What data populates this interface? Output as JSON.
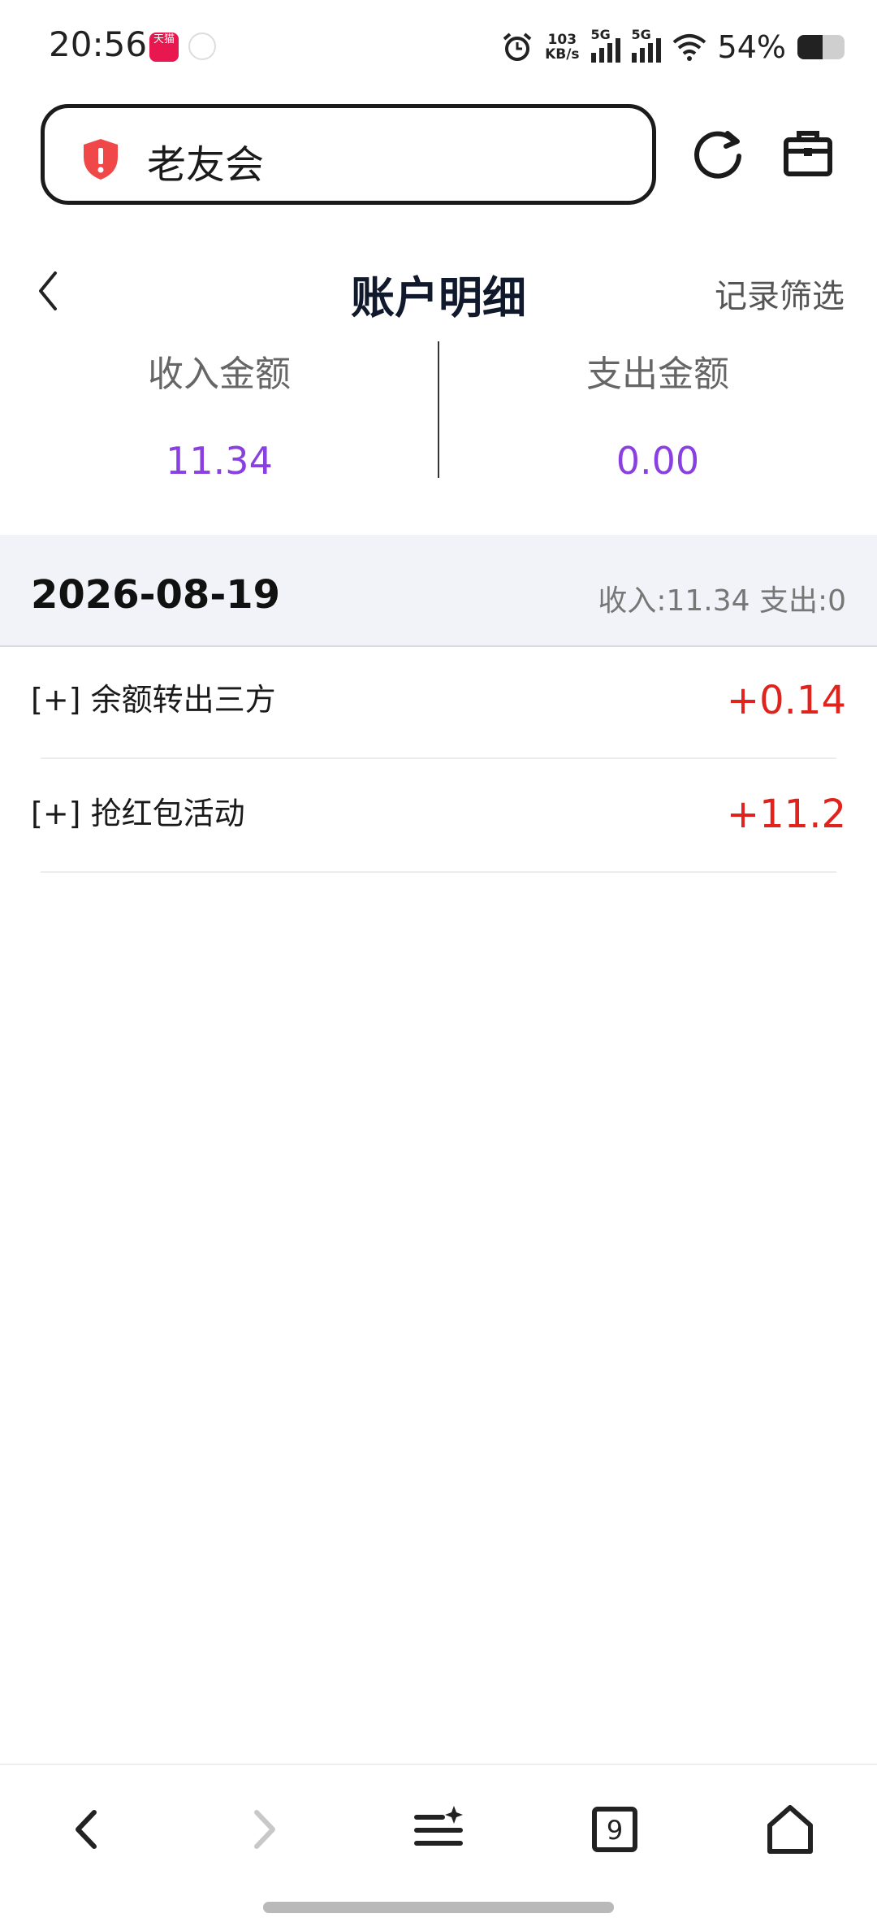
{
  "status_bar": {
    "time": "20:56",
    "tmall_badge": "天猫",
    "net_speed_value": "103",
    "net_speed_unit": "KB/s",
    "sim1_label": "5G",
    "sim2_label": "5G",
    "battery_text": "54%",
    "battery_level": 0.54
  },
  "browser": {
    "url_text": "老友会"
  },
  "header": {
    "title": "账户明细",
    "filter_label": "记录筛选"
  },
  "summary": {
    "income_label": "收入金额",
    "income_value": "11.34",
    "expense_label": "支出金额",
    "expense_value": "0.00"
  },
  "group": {
    "date": "2026-08-19",
    "stats": "收入:11.34  支出:0"
  },
  "records": [
    {
      "label": "[+] 余额转出三方",
      "amount": "+0.14"
    },
    {
      "label": "[+] 抢红包活动",
      "amount": "+11.2"
    }
  ],
  "bottom_nav": {
    "tabs_count": "9"
  },
  "colors": {
    "accent_purple": "#8a3fe0",
    "amount_red": "#e0231c",
    "shield_red": "#f04848"
  }
}
